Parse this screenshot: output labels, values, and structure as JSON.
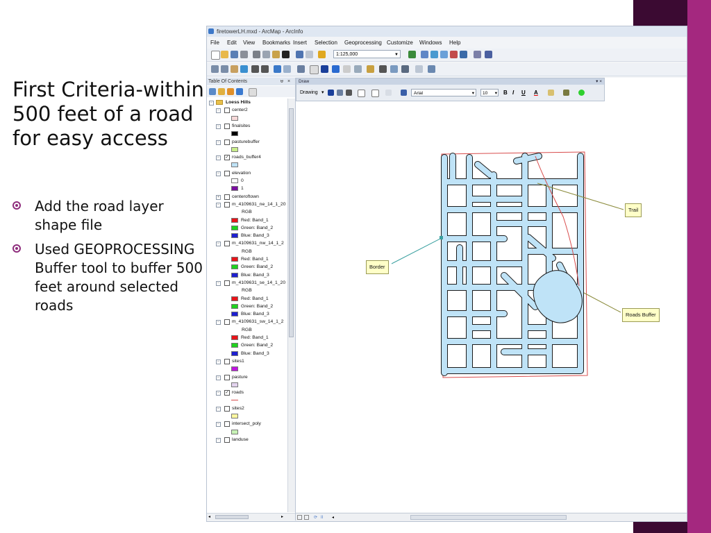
{
  "slide": {
    "heading": "First Criteria-within 500 feet of a road for easy access",
    "bullets": [
      "Add the road layer shape file",
      "Used GEOPROCESSING Buffer tool to buffer 500 feet around selected roads"
    ],
    "accent_colors": {
      "dark": "#3b0a32",
      "light": "#a4287f",
      "bullet": "#8e2d7c"
    }
  },
  "app": {
    "title": "firetowerLH.mxd - ArcMap - ArcInfo",
    "menus": [
      "File",
      "Edit",
      "View",
      "Bookmarks",
      "Insert",
      "Selection",
      "Geoprocessing",
      "Customize",
      "Windows",
      "Help"
    ],
    "scale": "1:125,000"
  },
  "toc": {
    "title": "Table Of Contents",
    "pin": "ᵾ",
    "close": "×",
    "group": "Loess Hills",
    "rows": [
      {
        "type": "layer",
        "label": "center2",
        "checked": false
      },
      {
        "type": "swatch",
        "color": "#f7d9d9"
      },
      {
        "type": "layer",
        "label": "finalsites",
        "checked": false
      },
      {
        "type": "swatch",
        "color": "#000000"
      },
      {
        "type": "layer",
        "label": "pasturebuffer",
        "checked": false
      },
      {
        "type": "swatch",
        "color": "#c9ee8a"
      },
      {
        "type": "layer",
        "label": "roads_buffer4",
        "checked": true
      },
      {
        "type": "swatch",
        "color": "#bfe3f7"
      },
      {
        "type": "layer",
        "label": "elevation",
        "checked": false
      },
      {
        "type": "legend",
        "color": "#ffffff",
        "label": "0"
      },
      {
        "type": "legend",
        "color": "#7b0fa0",
        "label": "1"
      },
      {
        "type": "layer",
        "label": "centeroftown",
        "checked": false,
        "collapsed": true
      },
      {
        "type": "layer",
        "label": "m_4109631_ne_14_1_20",
        "checked": false
      },
      {
        "type": "sub",
        "label": "RGB"
      },
      {
        "type": "legend",
        "color": "#e8141a",
        "label": "Red:   Band_1"
      },
      {
        "type": "legend",
        "color": "#1fd11f",
        "label": "Green: Band_2"
      },
      {
        "type": "legend",
        "color": "#1d1fd0",
        "label": "Blue:  Band_3"
      },
      {
        "type": "layer",
        "label": "m_4109631_nw_14_1_2",
        "checked": false
      },
      {
        "type": "sub",
        "label": "RGB"
      },
      {
        "type": "legend",
        "color": "#e8141a",
        "label": "Red:   Band_1"
      },
      {
        "type": "legend",
        "color": "#1fd11f",
        "label": "Green: Band_2"
      },
      {
        "type": "legend",
        "color": "#1d1fd0",
        "label": "Blue:  Band_3"
      },
      {
        "type": "layer",
        "label": "m_4109631_se_14_1_20",
        "checked": false
      },
      {
        "type": "sub",
        "label": "RGB"
      },
      {
        "type": "legend",
        "color": "#e8141a",
        "label": "Red:   Band_1"
      },
      {
        "type": "legend",
        "color": "#1fd11f",
        "label": "Green: Band_2"
      },
      {
        "type": "legend",
        "color": "#1d1fd0",
        "label": "Blue:  Band_3"
      },
      {
        "type": "layer",
        "label": "m_4109631_sw_14_1_2",
        "checked": false
      },
      {
        "type": "sub",
        "label": "RGB"
      },
      {
        "type": "legend",
        "color": "#e8141a",
        "label": "Red:   Band_1"
      },
      {
        "type": "legend",
        "color": "#1fd11f",
        "label": "Green: Band_2"
      },
      {
        "type": "legend",
        "color": "#1d1fd0",
        "label": "Blue:  Band_3"
      },
      {
        "type": "layer",
        "label": "sites1",
        "checked": false
      },
      {
        "type": "swatch",
        "color": "#c017e0"
      },
      {
        "type": "layer",
        "label": "pasture",
        "checked": false
      },
      {
        "type": "swatch",
        "color": "#e3d3ee"
      },
      {
        "type": "layer",
        "label": "roads",
        "checked": true
      },
      {
        "type": "line",
        "color": "#d84b4b"
      },
      {
        "type": "layer",
        "label": "sites2",
        "checked": false
      },
      {
        "type": "swatch",
        "color": "#fbf7a0"
      },
      {
        "type": "layer",
        "label": "intersect_poly",
        "checked": false
      },
      {
        "type": "swatch",
        "color": "#c7f2b5"
      },
      {
        "type": "layer",
        "label": "landuse",
        "checked": false
      }
    ]
  },
  "draw": {
    "title": "Draw",
    "close": "▾ ×",
    "drawing_label": "Drawing",
    "font": "Arial",
    "size": "10",
    "bold": "B",
    "italic": "I",
    "underline": "U",
    "font_color": "A"
  },
  "map": {
    "buffer_color": "#bfe3f7",
    "border_color": "#d84b4b",
    "callouts": [
      {
        "label": "Trail"
      },
      {
        "label": "Border"
      },
      {
        "label": "Roads Buffer"
      }
    ]
  }
}
